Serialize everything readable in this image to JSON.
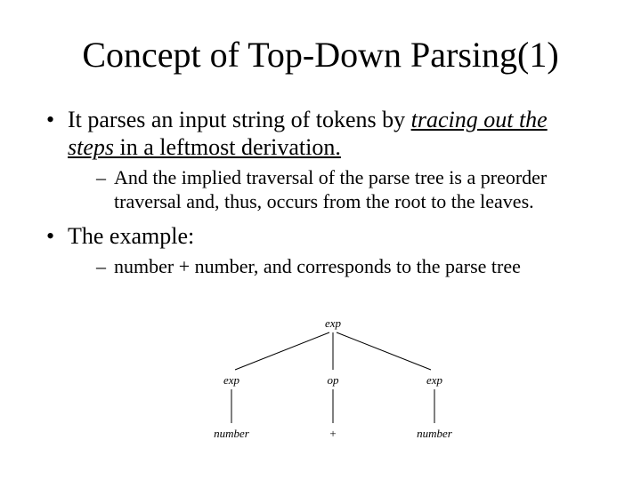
{
  "title": "Concept of Top-Down Parsing(1)",
  "bullets": {
    "b1_pre": "It parses an input string of tokens by ",
    "b1_em": "tracing out the steps",
    "b1_post": " in a leftmost derivation.",
    "b1_sub": "And the implied traversal of the parse tree is a preorder traversal and, thus, occurs from the root to the leaves.",
    "b2": "The example:",
    "b2_sub": "number + number,   and corresponds to the parse tree"
  },
  "tree": {
    "root": "exp",
    "c1": "exp",
    "c2": "op",
    "c3": "exp",
    "l1": "number",
    "l2": "+",
    "l3": "number"
  }
}
